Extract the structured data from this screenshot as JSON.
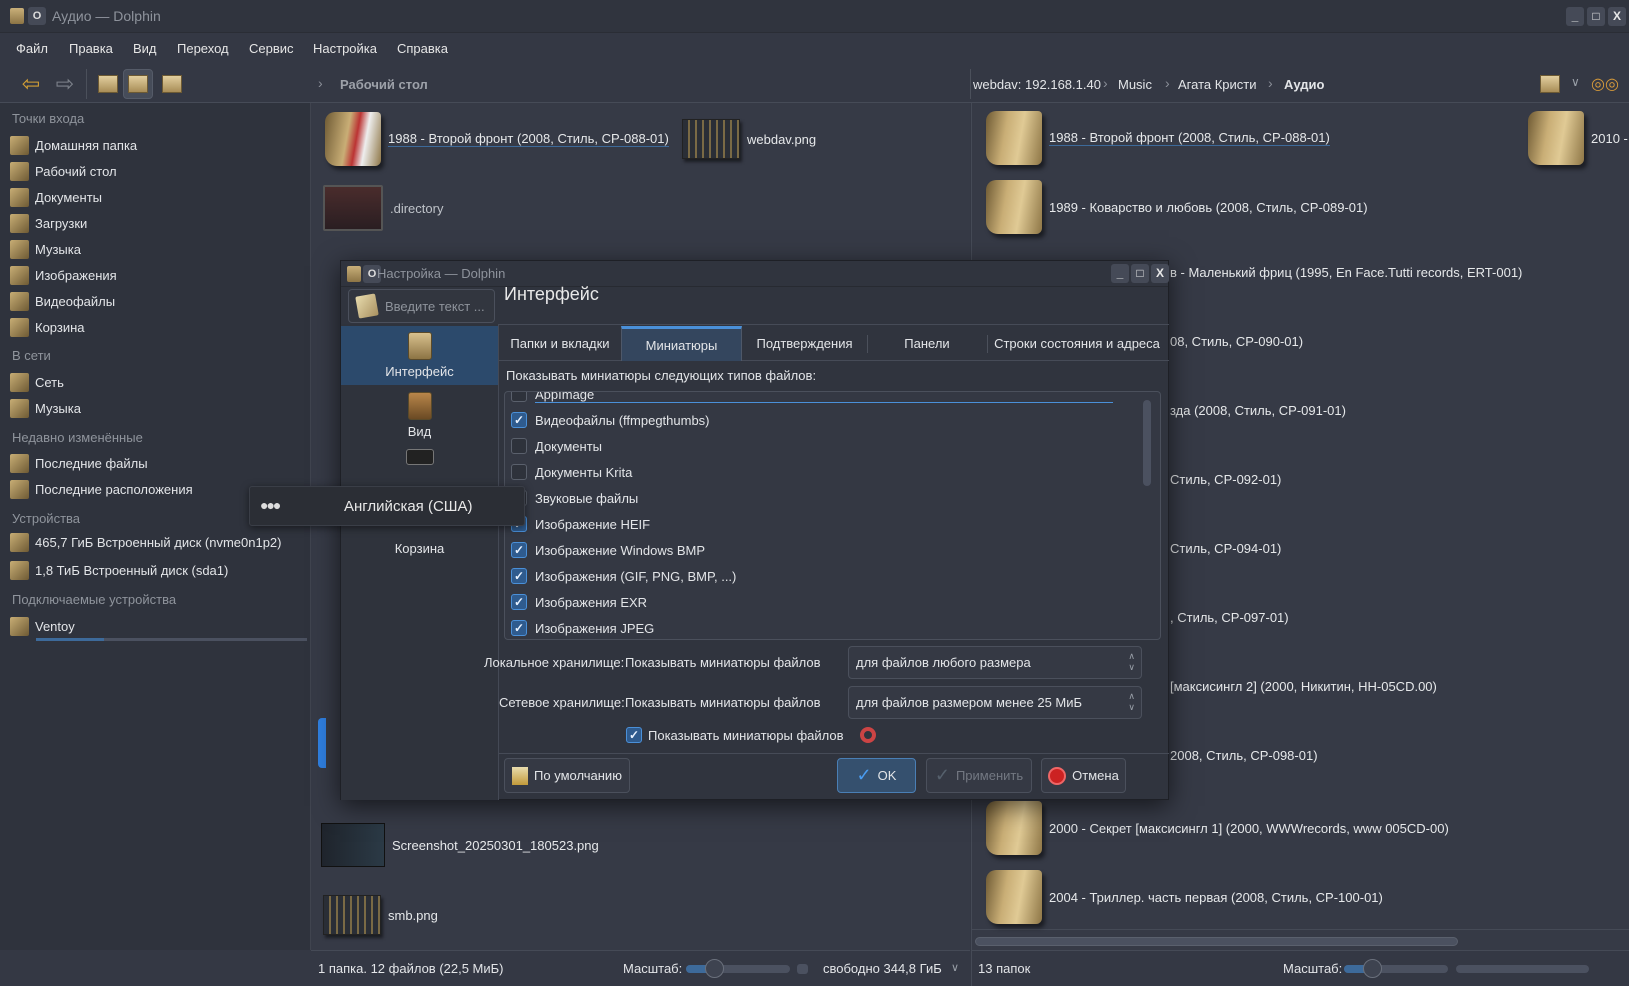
{
  "window": {
    "title": "Аудио — Dolphin"
  },
  "menu": [
    "Файл",
    "Правка",
    "Вид",
    "Переход",
    "Сервис",
    "Настройка",
    "Справка"
  ],
  "breadcrumb_left": {
    "current": "Рабочий стол"
  },
  "breadcrumb_right": {
    "items": [
      "webdav: 192.168.1.40",
      "Music",
      "Агата Кристи"
    ],
    "current": "Аудио"
  },
  "sidebar": {
    "sections": [
      {
        "title": "Точки входа",
        "items": [
          "Домашняя папка",
          "Рабочий стол",
          "Документы",
          "Загрузки",
          "Музыка",
          "Изображения",
          "Видеофайлы",
          "Корзина"
        ]
      },
      {
        "title": "В сети",
        "items": [
          "Сеть",
          "Музыка"
        ]
      },
      {
        "title": "Недавно изменённые",
        "items": [
          "Последние файлы",
          "Последние расположения"
        ]
      },
      {
        "title": "Устройства",
        "items": [
          "465,7 ГиБ Встроенный диск (nvme0n1p2)",
          "1,8 ТиБ Встроенный диск (sda1)"
        ]
      },
      {
        "title": "Подключаемые устройства",
        "items": [
          "Ventoy"
        ]
      }
    ],
    "disk_usage_fraction": 0.25
  },
  "left_pane": {
    "files": [
      {
        "name": "1988 - Второй фронт (2008, Стиль, CP-088-01)",
        "type": "folder"
      },
      {
        "name": "webdav.png",
        "type": "image"
      },
      {
        "name": ".directory",
        "type": "directory"
      },
      {
        "name": "Screenshot_20250301_180523.png",
        "type": "screenshot"
      },
      {
        "name": "smb.png",
        "type": "image"
      }
    ],
    "status": "1 папка. 12 файлов (22,5 МиБ)",
    "zoom_label": "Масштаб:",
    "zoom_fraction": 0.28,
    "free_space": "свободно 344,8 ГиБ"
  },
  "right_pane": {
    "folders": [
      "1988 - Второй фронт (2008, Стиль, CP-088-01)",
      "1989 - Коварство и любовь (2008, Стиль, CP-089-01)",
      "в - Маленький фриц (1995, En Face.Tutti records, ERT-001)",
      "08, Стиль, CP-090-01)",
      "зда (2008, Стиль, CP-091-01)",
      "Стиль, CP-092-01)",
      "Стиль, CP-094-01)",
      ", Стиль, CP-097-01)",
      "[максисингл 2] (2000, Никитин, HH-05CD.00)",
      "2008, Стиль, CP-098-01)",
      "2000 - Секрет [максисингл 1] (2000, WWWrecords, www 005CD-00)",
      "2004 - Триллер. часть первая (2008, Стиль, CP-100-01)"
    ],
    "second_column": "2010 -",
    "status": "13 папок",
    "zoom_label": "Масштаб:",
    "zoom_fraction": 0.28
  },
  "dialog": {
    "title": "Настройка — Dolphin",
    "search_placeholder": "Введите текст ...",
    "header": "Интерфейс",
    "categories": [
      "Интерфейс",
      "Вид",
      "",
      "Корзина"
    ],
    "tabs": [
      "Папки и вкладки",
      "Миниатюры",
      "Подтверждения",
      "Панели",
      "Строки состояния и адреса"
    ],
    "active_tab": 1,
    "list_label": "Показывать миниатюры следующих типов файлов:",
    "file_types": [
      {
        "label": "AppImage",
        "checked": false
      },
      {
        "label": "Видеофайлы (ffmpegthumbs)",
        "checked": true
      },
      {
        "label": "Документы",
        "checked": false
      },
      {
        "label": "Документы Krita",
        "checked": false
      },
      {
        "label": "Звуковые файлы",
        "checked": false
      },
      {
        "label": "Изображение HEIF",
        "checked": true
      },
      {
        "label": "Изображение Windows BMP",
        "checked": true
      },
      {
        "label": "Изображения (GIF, PNG, BMP, ...)",
        "checked": true
      },
      {
        "label": "Изображения EXR",
        "checked": true
      },
      {
        "label": "Изображения JPEG",
        "checked": true
      }
    ],
    "local_label": "Локальное хранилище:",
    "network_label": "Сетевое хранилище:",
    "show_thumbs_label": "Показывать миниатюры файлов",
    "local_value": "для файлов любого размера",
    "network_value": "для файлов размером менее 25 МиБ",
    "show_thumbs_checkbox": "Показывать миниатюры файлов",
    "buttons": {
      "defaults": "По умолчанию",
      "ok": "OK",
      "apply": "Применить",
      "cancel": "Отмена"
    }
  },
  "tooltip": {
    "text": "Английская (США)"
  }
}
